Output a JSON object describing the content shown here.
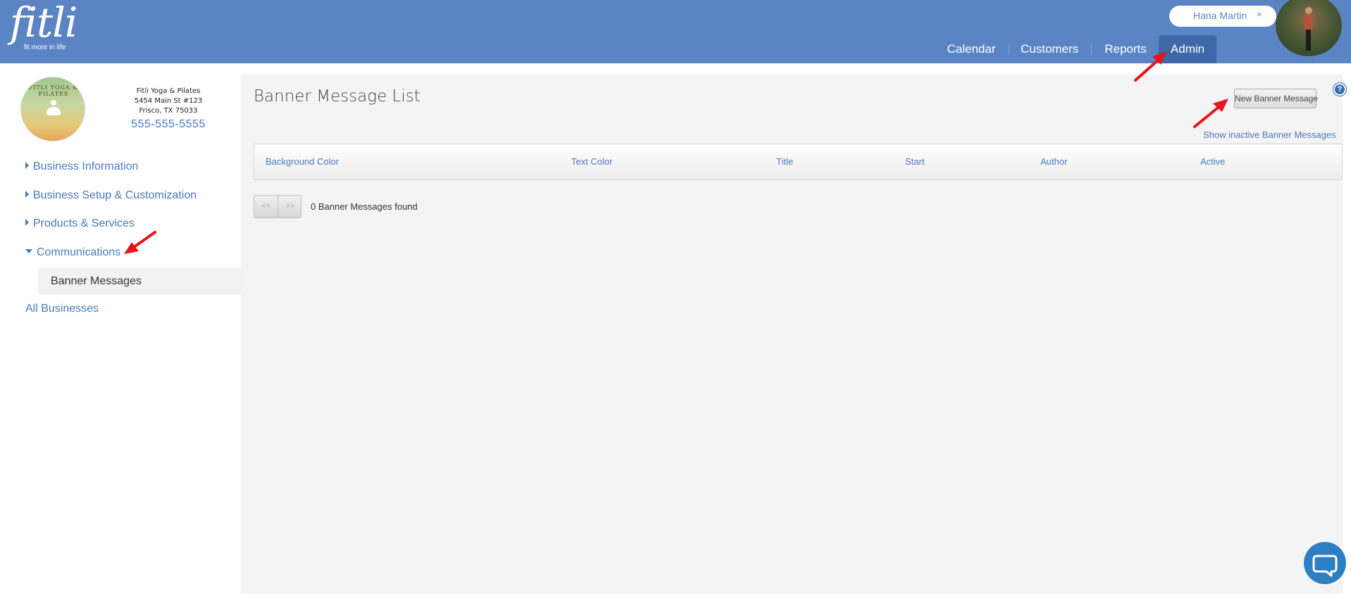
{
  "header": {
    "logo_word": "fitli",
    "logo_tagline": "fit more in life",
    "user_name": "Hana Martin",
    "user_chevron": "»",
    "nav": [
      {
        "label": "Calendar"
      },
      {
        "label": "Customers"
      },
      {
        "label": "Reports"
      },
      {
        "label": "Admin",
        "active": true
      }
    ]
  },
  "sidebar": {
    "biz_logo_text": "FITLI YOGA & PILATES",
    "biz_name": "Fitli Yoga & Pilates",
    "biz_address1": "5454 Main St #123",
    "biz_address2": "Frisco, TX 75033",
    "biz_phone": "555-555-5555",
    "items": [
      {
        "label": "Business Information"
      },
      {
        "label": "Business Setup & Customization"
      },
      {
        "label": "Products & Services"
      },
      {
        "label": "Communications"
      }
    ],
    "sub_item": "Banner Messages",
    "all_businesses": "All Businesses"
  },
  "main": {
    "title": "Banner Message List",
    "new_button": "New Banner Message",
    "help_glyph": "?",
    "inactive_link": "Show inactive Banner Messages",
    "columns": [
      "Background Color",
      "Text Color",
      "Title",
      "Start",
      "Author",
      "Active"
    ],
    "pager_prev": "<<",
    "pager_next": ">>",
    "found_text": "0 Banner Messages found"
  },
  "colors": {
    "header_bg": "#5b84c4",
    "nav_active_bg": "#3f68a8",
    "link": "#4a78bd",
    "annotation_arrow": "#e8141c"
  }
}
